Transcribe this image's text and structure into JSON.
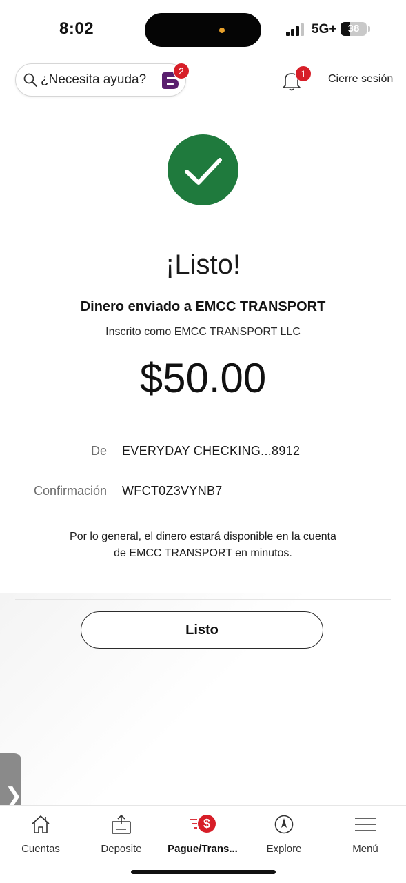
{
  "status_bar": {
    "time": "8:02",
    "network": "5G+",
    "battery": "38"
  },
  "header": {
    "help_text": "¿Necesita ayuda?",
    "assistant_badge": "2",
    "notification_badge": "1",
    "logout": "Cierre sesión"
  },
  "confirmation": {
    "headline": "¡Listo!",
    "recipient_title": "Dinero enviado a EMCC TRANSPORT",
    "enrolled_as": "Inscrito como EMCC TRANSPORT LLC",
    "amount": "$50.00",
    "details": [
      {
        "label": "De",
        "value": "EVERYDAY CHECKING...8912"
      },
      {
        "label": "Confirmación",
        "value": "WFCT0Z3VYNB7"
      }
    ],
    "note_line1": "Por lo general, el dinero estará disponible en la cuenta",
    "note_line2": "de EMCC TRANSPORT en minutos.",
    "done_label": "Listo"
  },
  "bottom_nav": [
    {
      "label": "Cuentas",
      "icon": "home-icon"
    },
    {
      "label": "Deposite",
      "icon": "deposit-icon"
    },
    {
      "label": "Pague/Trans...",
      "icon": "pay-transfer-icon",
      "active": true
    },
    {
      "label": "Explore",
      "icon": "compass-icon"
    },
    {
      "label": "Menú",
      "icon": "hamburger-icon"
    }
  ],
  "colors": {
    "success_green": "#1f7a3d",
    "brand_red": "#d71e28",
    "assistant_purple": "#5a1f6e"
  }
}
